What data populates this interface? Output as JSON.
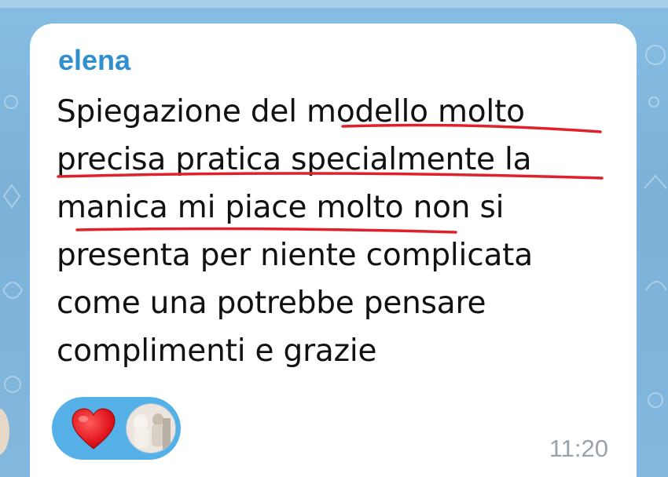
{
  "message": {
    "sender": "elena",
    "lines": [
      "Spiegazione del modello molto",
      "precisa pratica specialmente la",
      "manica mi piace molto non si",
      "presenta per niente complicata",
      "come una potrebbe pensare",
      "complimenti e grazie"
    ],
    "time": "11:20"
  },
  "reactions": [
    {
      "icon": "heart-icon",
      "type": "emoji"
    },
    {
      "icon": "reactor-avatar",
      "type": "avatar"
    }
  ],
  "colors": {
    "sender": "#2f8fcf",
    "underline": "#e0202a",
    "reaction_pill": "#55b0e8",
    "timestamp": "#9aa3ab",
    "background": "#7fb3d9"
  }
}
